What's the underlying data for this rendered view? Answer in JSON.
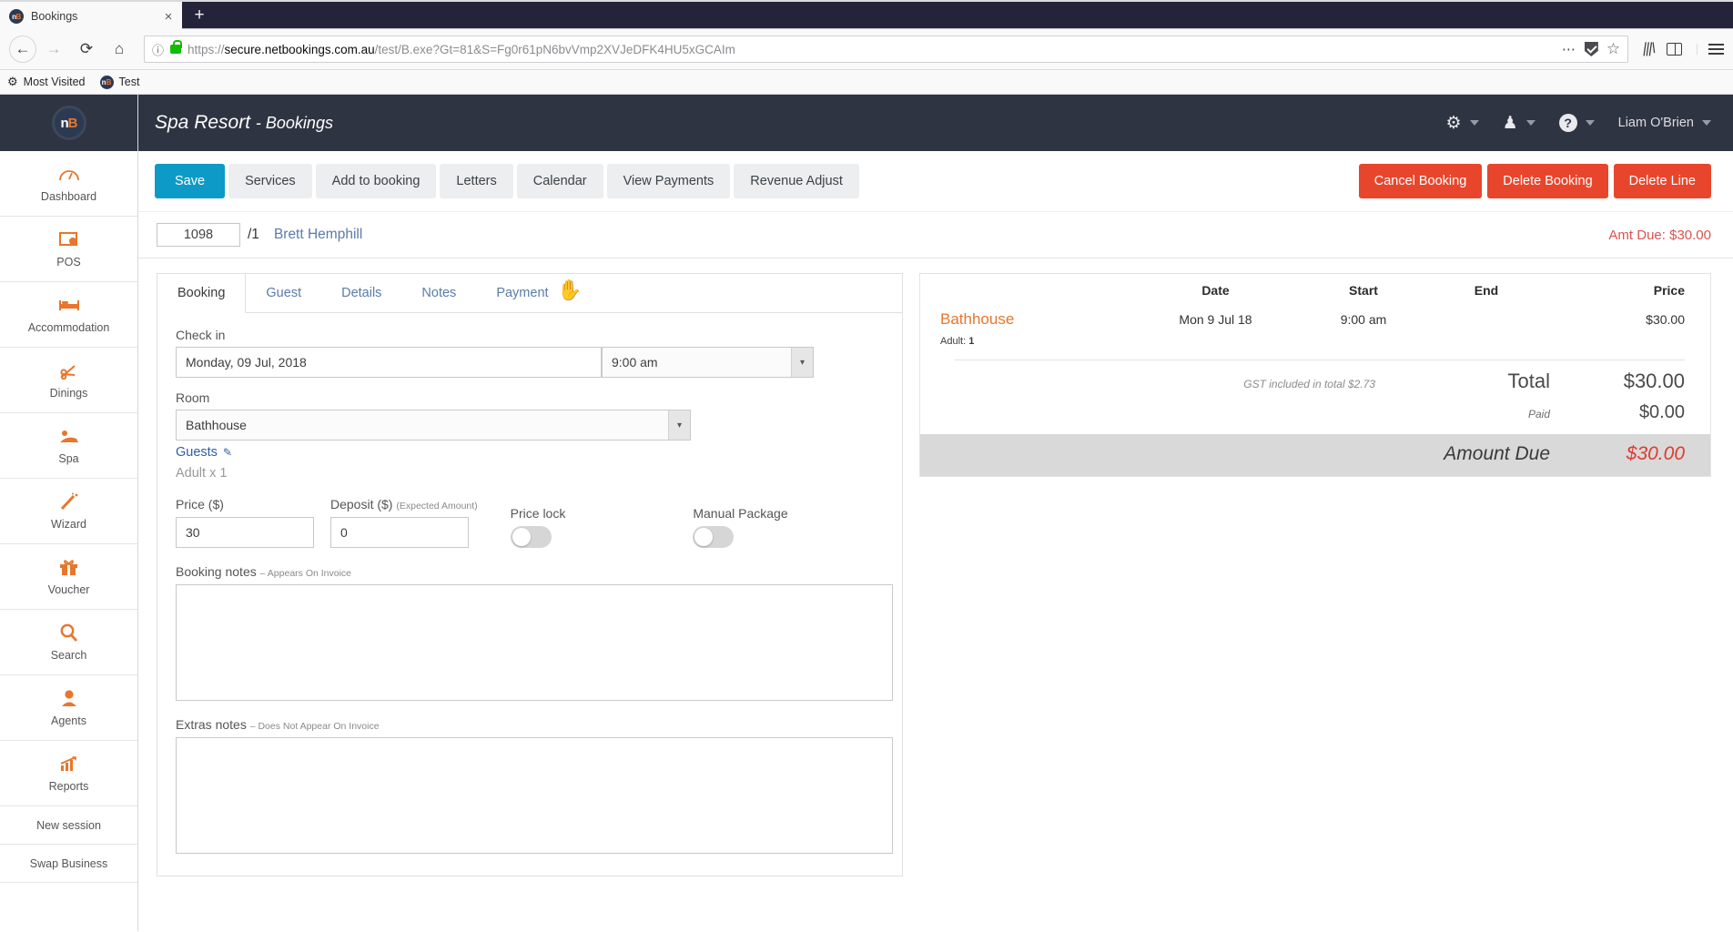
{
  "browser": {
    "tab_title": "Bookings",
    "tab_favicon": "nb-logo-icon",
    "close_label": "×",
    "newtab_label": "+",
    "url": "https://secure.netbookings.com.au/test/B.exe?Gt=81&S=Fg0r61pN6bvVmp2XVJeDFK4HU5xGCAIm",
    "url_host": "secure.netbookings.com.au",
    "bookmarks": [
      {
        "label": "Most Visited",
        "icon": "gear-icon"
      },
      {
        "label": "Test",
        "icon": "nb-logo-icon"
      }
    ]
  },
  "sidebar": {
    "logo_text": "nB",
    "items": [
      {
        "label": "Dashboard",
        "icon": "◔"
      },
      {
        "label": "POS",
        "icon": "▣"
      },
      {
        "label": "Accommodation",
        "icon": "Ὤf"
      },
      {
        "label": "Dinings",
        "icon": "✄"
      },
      {
        "label": "Spa",
        "icon": "♓"
      },
      {
        "label": "Wizard",
        "icon": "✐"
      },
      {
        "label": "Voucher",
        "icon": "❀"
      },
      {
        "label": "Search",
        "icon": "⚲"
      },
      {
        "label": "Agents",
        "icon": "☺"
      },
      {
        "label": "Reports",
        "icon": "↗"
      }
    ],
    "plain_items": [
      {
        "label": "New session"
      },
      {
        "label": "Swap Business"
      }
    ]
  },
  "header": {
    "business": "Spa Resort",
    "section": "- Bookings",
    "settings_icon": "gears-icon",
    "user_icon": "person-icon",
    "help_icon": "question-mark-icon",
    "user_name": "Liam O'Brien"
  },
  "toolbar": {
    "save_label": "Save",
    "buttons": [
      {
        "label": "Services"
      },
      {
        "label": "Add to booking"
      },
      {
        "label": "Letters"
      },
      {
        "label": "Calendar"
      },
      {
        "label": "View Payments"
      },
      {
        "label": "Revenue Adjust"
      }
    ],
    "danger_buttons": [
      {
        "label": "Cancel Booking"
      },
      {
        "label": "Delete Booking"
      },
      {
        "label": "Delete Line"
      }
    ],
    "accent_primary": "#0e9ac7",
    "accent_danger": "#e8462c"
  },
  "booking": {
    "id": "1098",
    "line": "/1",
    "guest_name": "Brett Hemphill",
    "amount_due_label": "Amt Due: $30.00"
  },
  "tabs": [
    {
      "label": "Booking",
      "active": true
    },
    {
      "label": "Guest",
      "active": false
    },
    {
      "label": "Details",
      "active": false
    },
    {
      "label": "Notes",
      "active": false
    },
    {
      "label": "Payment",
      "active": false
    }
  ],
  "form": {
    "checkin_label": "Check in",
    "checkin_date": "Monday, 09 Jul, 2018",
    "checkin_time": "9:00 am",
    "room_label": "Room",
    "room_value": "Bathhouse",
    "guests_label": "Guests",
    "guests_edit_icon": "pencil-icon",
    "guests_summary": "Adult x 1",
    "price_label": "Price ($)",
    "price_value": "30",
    "deposit_label": "Deposit ($)",
    "deposit_hint": "(Expected Amount)",
    "deposit_value": "0",
    "price_lock_label": "Price lock",
    "price_lock_on": false,
    "manual_package_label": "Manual Package",
    "manual_package_on": false,
    "booking_notes_label": "Booking notes",
    "booking_notes_hint": "– Appears On Invoice",
    "booking_notes_value": "",
    "extras_notes_label": "Extras notes",
    "extras_notes_hint": "– Does Not Appear On Invoice",
    "extras_notes_value": ""
  },
  "summary": {
    "columns": {
      "name": "",
      "date": "Date",
      "start": "Start",
      "end": "End",
      "price": "Price"
    },
    "rows": [
      {
        "name": "Bathhouse",
        "date": "Mon 9 Jul 18",
        "start": "9:00 am",
        "end": "",
        "price": "$30.00",
        "guests": "Adult:",
        "guests_count": "1"
      }
    ],
    "gst_note": "GST included in total $2.73",
    "total_label": "Total",
    "total_value": "$30.00",
    "paid_label": "Paid",
    "paid_value": "$0.00",
    "due_label": "Amount Due",
    "due_value": "$30.00",
    "due_color": "#e03a2f"
  }
}
